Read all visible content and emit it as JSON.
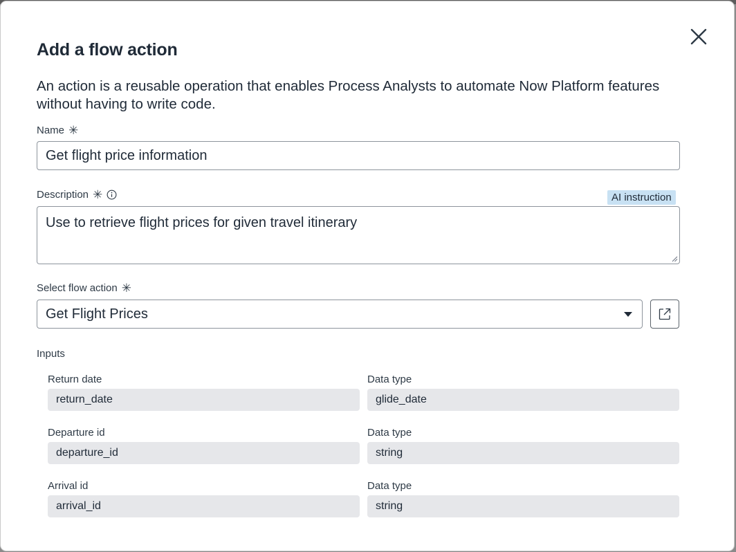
{
  "dialog": {
    "title": "Add a flow action",
    "intro": "An action is a reusable operation that enables Process Analysts to automate Now Platform features without having to write code.",
    "close_icon": "close-icon"
  },
  "name_field": {
    "label": "Name",
    "value": "Get flight price information"
  },
  "description_field": {
    "label": "Description",
    "badge": "AI instruction",
    "value": "Use to retrieve flight prices for given travel itinerary"
  },
  "flow_action": {
    "label": "Select flow action",
    "selected": "Get Flight Prices",
    "open_icon": "external-link-icon"
  },
  "inputs": {
    "heading": "Inputs",
    "rows": [
      {
        "name_label": "Return date",
        "name_value": "return_date",
        "type_label": "Data type",
        "type_value": "glide_date"
      },
      {
        "name_label": "Departure id",
        "name_value": "departure_id",
        "type_label": "Data type",
        "type_value": "string"
      },
      {
        "name_label": "Arrival id",
        "name_value": "arrival_id",
        "type_label": "Data type",
        "type_value": "string"
      }
    ]
  },
  "required_marker": "✳"
}
